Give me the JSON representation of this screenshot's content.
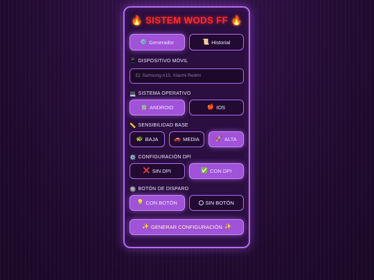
{
  "app": {
    "title": "SISTEM WODS FF",
    "title_icon": "fire-icon"
  },
  "tabs": [
    {
      "label": "Generador",
      "icon": "gear-icon",
      "glyph": "⚙️",
      "active": true
    },
    {
      "label": "Historial",
      "icon": "scroll-icon",
      "glyph": "📜",
      "active": false
    }
  ],
  "device": {
    "label": "DISPOSITIVO MÓVIL",
    "icon": "phone-icon",
    "glyph": "📱",
    "placeholder": "Ej: Samsung A15, Xiaomi Redmi",
    "value": ""
  },
  "os": {
    "label": "SISTEMA OPERATIVO",
    "icon": "laptop-icon",
    "glyph": "💻",
    "options": [
      {
        "label": "ANDROID",
        "icon": "android-icon",
        "glyph": "🤖",
        "active": true
      },
      {
        "label": "IOS",
        "icon": "apple-icon",
        "glyph": "🍎",
        "active": false
      }
    ]
  },
  "sensitivity": {
    "label": "SENSIBILIDAD BASE",
    "icon": "ruler-icon",
    "glyph": "📏",
    "options": [
      {
        "label": "BAJA",
        "icon": "turtle-icon",
        "glyph": "🐢",
        "active": false
      },
      {
        "label": "MEDIA",
        "icon": "car-icon",
        "glyph": "🚗",
        "active": false
      },
      {
        "label": "ALTA",
        "icon": "rocket-icon",
        "glyph": "🚀",
        "active": true
      }
    ]
  },
  "dpi": {
    "label": "CONFIGURACIÓN DPI",
    "icon": "gear-icon",
    "glyph": "⚙️",
    "options": [
      {
        "label": "SIN DPI",
        "icon": "cross-icon",
        "glyph": "❌",
        "active": false
      },
      {
        "label": "CON DPI",
        "icon": "check-icon",
        "glyph": "✅",
        "active": true
      }
    ]
  },
  "fire_button": {
    "label": "BOTÓN DE DISPARO",
    "icon": "target-icon",
    "glyph": "🔘",
    "options": [
      {
        "label": "CON BOTÓN",
        "icon": "lightbulb-icon",
        "glyph": "💡",
        "active": true
      },
      {
        "label": "SIN BOTÓN",
        "icon": "circle-icon",
        "glyph": "",
        "active": false
      }
    ]
  },
  "generate": {
    "label": "GENERAR CONFIGURACIÓN",
    "icon": "sparkles-icon",
    "glyph": "✨"
  },
  "colors": {
    "accent": "#a052d8",
    "border": "#b46cf0",
    "title": "#ff2b2b",
    "background": "#1f0a2c"
  }
}
